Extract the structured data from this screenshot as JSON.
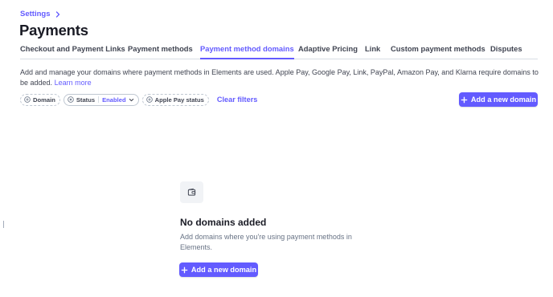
{
  "breadcrumb": {
    "settings_label": "Settings"
  },
  "page_title": "Payments",
  "tabs": [
    {
      "label": "Checkout and Payment Links",
      "active": false
    },
    {
      "label": "Payment methods",
      "active": false
    },
    {
      "label": "Payment method domains",
      "active": true
    },
    {
      "label": "Adaptive Pricing",
      "active": false
    },
    {
      "label": "Link",
      "active": false
    },
    {
      "label": "Custom payment methods",
      "active": false
    },
    {
      "label": "Disputes",
      "active": false
    }
  ],
  "description": {
    "text": "Add and manage your domains where payment methods in Elements are used. Apple Pay, Google Pay, Link, PayPal, Amazon Pay, and Klarna require domains to be added.",
    "learn_more": "Learn more"
  },
  "filters": {
    "domain_label": "Domain",
    "status_label": "Status",
    "status_value": "Enabled",
    "apple_pay_label": "Apple Pay status",
    "clear_label": "Clear filters"
  },
  "add_domain_button": "Add a new domain",
  "empty_state": {
    "icon": "wallet-icon",
    "title": "No domains added",
    "description": "Add domains where you're using payment methods in Elements.",
    "button_label": "Add a new domain"
  },
  "colors": {
    "accent": "#635bff",
    "text": "#414552",
    "heading": "#1a1b25",
    "muted": "#687385"
  }
}
